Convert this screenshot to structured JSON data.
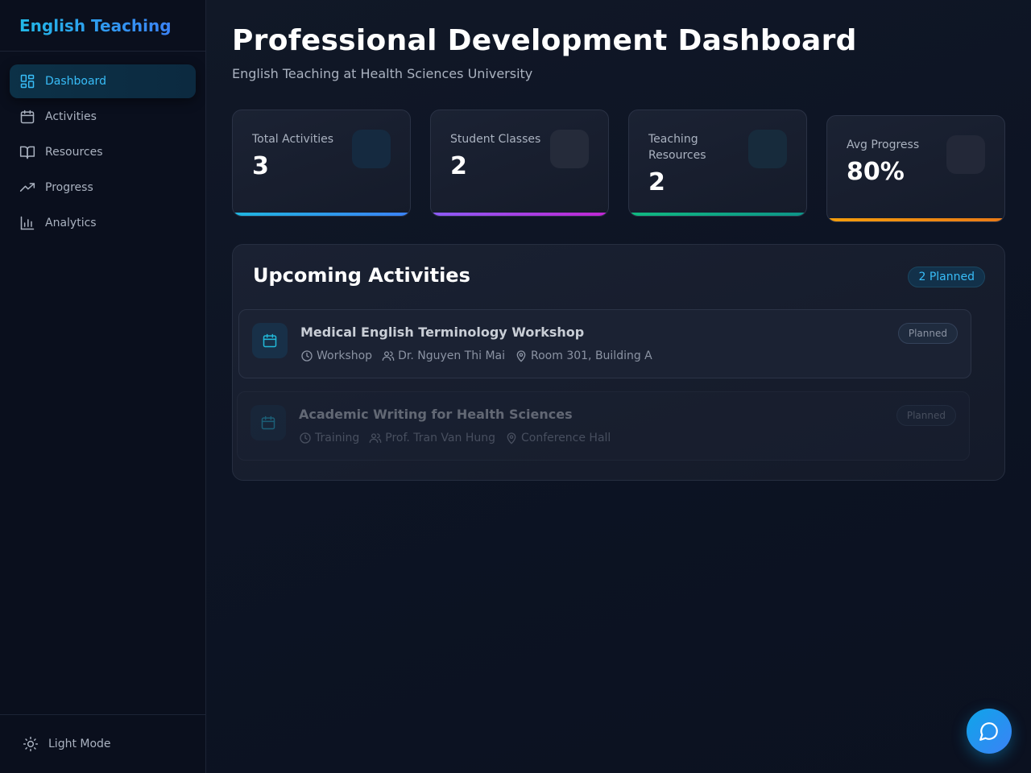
{
  "brand": {
    "name": "English Teaching"
  },
  "sidebar": {
    "items": [
      {
        "label": "Dashboard",
        "icon": "dashboard-icon",
        "active": true
      },
      {
        "label": "Activities",
        "icon": "calendar-icon"
      },
      {
        "label": "Resources",
        "icon": "book-icon"
      },
      {
        "label": "Progress",
        "icon": "trending-up-icon"
      },
      {
        "label": "Analytics",
        "icon": "bar-chart-icon"
      }
    ],
    "theme_toggle": {
      "label": "Light Mode",
      "icon": "sun-icon"
    }
  },
  "header": {
    "title": "Professional Development Dashboard",
    "subtitle": "English Teaching at Health Sciences University"
  },
  "stats": [
    {
      "label": "Total Activities",
      "value": "3",
      "accent": "#3b82f6"
    },
    {
      "label": "Student Classes",
      "value": "2",
      "accent": "#a855f7"
    },
    {
      "label": "Teaching Resources",
      "value": "2",
      "accent": "#10b981"
    },
    {
      "label": "Avg Progress",
      "value": "80%",
      "accent": "#f59e0b"
    }
  ],
  "upcoming": {
    "title": "Upcoming Activities",
    "badge": "2 Planned",
    "items": [
      {
        "title": "Medical English Terminology Workshop",
        "type": "Workshop",
        "person": "Dr. Nguyen Thi Mai",
        "location": "Room 301, Building A",
        "status": "Planned"
      },
      {
        "title": "Academic Writing for Health Sciences",
        "type": "Training",
        "person": "Prof. Tran Van Hung",
        "location": "Conference Hall",
        "status": "Planned"
      }
    ]
  },
  "chat": {
    "icon": "chat-bubble-icon"
  },
  "colors": {
    "accent": "#38bdf8",
    "background": "#0b1120"
  }
}
